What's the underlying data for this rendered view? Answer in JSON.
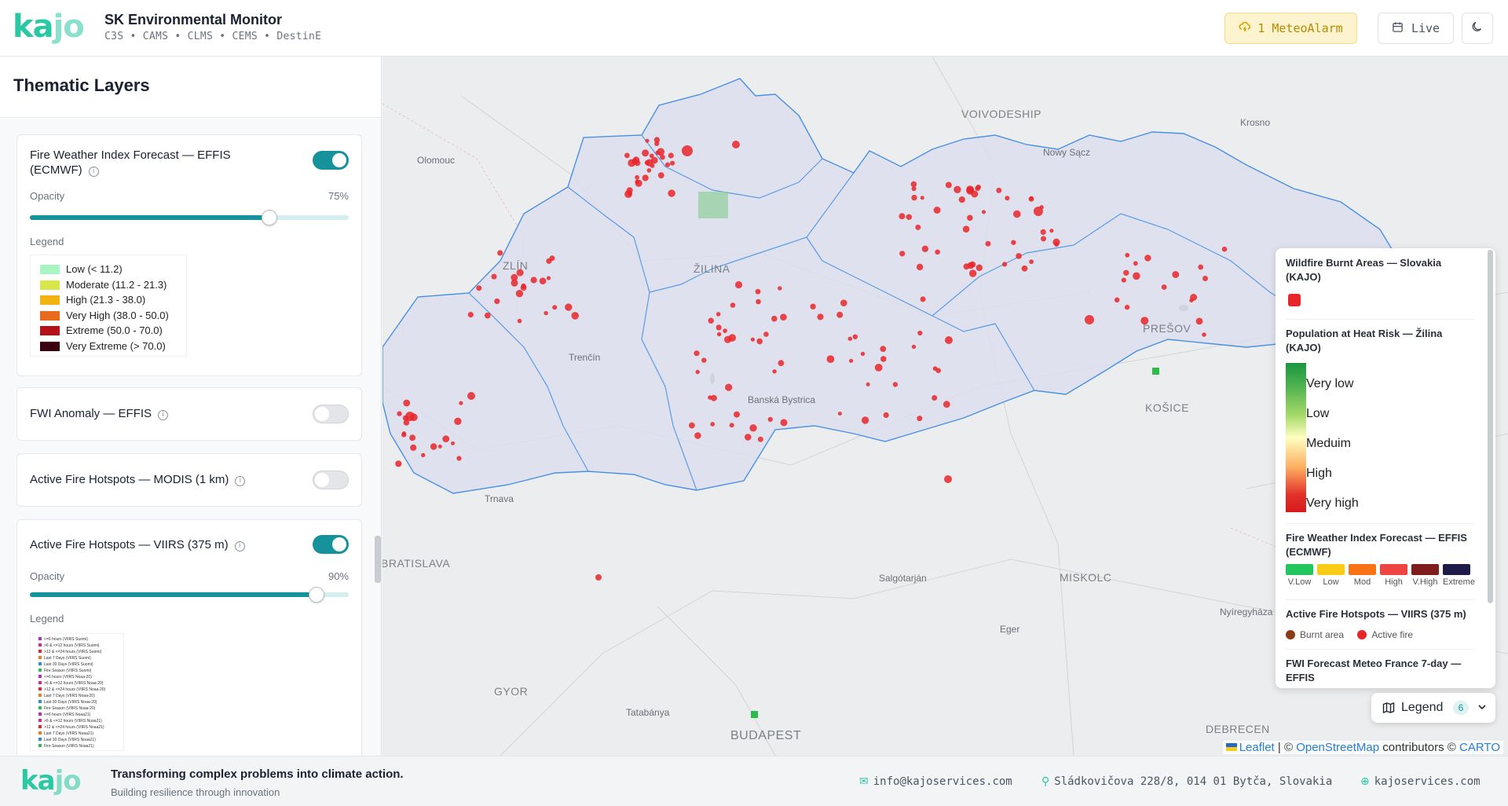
{
  "header": {
    "logo": "kajo",
    "title": "SK Environmental Monitor",
    "subtitle": "C3S • CAMS • CLMS • CEMS • DestinE",
    "alarm_label": "1 MeteoAlarm",
    "live_label": "Live"
  },
  "sidebar": {
    "title": "Thematic Layers",
    "layers": [
      {
        "title": "Fire Weather Index Forecast — EFFIS (ECMWF)",
        "enabled": true,
        "opacity_label": "Opacity",
        "opacity": "75%",
        "opacity_fraction": 0.75,
        "legend_label": "Legend",
        "legend": [
          {
            "label": "Low (< 11.2)",
            "color": "#a8f5c2"
          },
          {
            "label": "Moderate (11.2 - 21.3)",
            "color": "#d7e64a"
          },
          {
            "label": "High (21.3 - 38.0)",
            "color": "#f0b30f"
          },
          {
            "label": "Very High (38.0 - 50.0)",
            "color": "#e86a1d"
          },
          {
            "label": "Extreme (50.0 - 70.0)",
            "color": "#b5111b"
          },
          {
            "label": "Very Extreme (> 70.0)",
            "color": "#3b0010"
          }
        ]
      },
      {
        "title": "FWI Anomaly — EFFIS",
        "enabled": false
      },
      {
        "title": "Active Fire Hotspots — MODIS (1 km)",
        "enabled": false
      },
      {
        "title": "Active Fire Hotspots — VIIRS (375 m)",
        "enabled": true,
        "opacity_label": "Opacity",
        "opacity": "90%",
        "opacity_fraction": 0.9,
        "legend_label": "Legend",
        "legend_small": [
          {
            "label": "<=6 hours (VIIRS Suomi)",
            "color": "#c01fd6"
          },
          {
            "label": ">6 & <=12 hours (VIIRS Suomi)",
            "color": "#e01f9c"
          },
          {
            "label": ">12 & <=24 hours (VIIRS Suomi)",
            "color": "#ee2222"
          },
          {
            "label": "Last 7 Days (VIIRS Suomi)",
            "color": "#f07c14"
          },
          {
            "label": "Last 30 Days (VIIRS Suomi)",
            "color": "#2e8bd6"
          },
          {
            "label": "Fire Season (VIIRS Suomi)",
            "color": "#2ebd5a"
          },
          {
            "label": "<=6 hours (VIIRS Noaa-20)",
            "color": "#c01fd6"
          },
          {
            "label": ">6 & <=12 hours (VIIRS Noaa-20)",
            "color": "#e01f9c"
          },
          {
            "label": ">12 & <=24 hours (VIIRS Noaa-20)",
            "color": "#ee2222"
          },
          {
            "label": "Last 7 Days (VIIRS Noaa-20)",
            "color": "#f07c14"
          },
          {
            "label": "Last 30 Days (VIIRS Noaa-20)",
            "color": "#2e8bd6"
          },
          {
            "label": "Fire Season (VIIRS Noaa-20)",
            "color": "#2ebd5a"
          },
          {
            "label": "<=6 hours (VIIRS Noaa21)",
            "color": "#c01fd6"
          },
          {
            "label": ">6 & <=12 hours (VIIRS Noaa21)",
            "color": "#e01f9c"
          },
          {
            "label": ">12 & <=24 hours (VIIRS Noaa21)",
            "color": "#ee2222"
          },
          {
            "label": "Last 7 Days (VIIRS Noaa21)",
            "color": "#f07c14"
          },
          {
            "label": "Last 30 Days (VIIRS Noaa21)",
            "color": "#2e8bd6"
          },
          {
            "label": "Fire Season (VIIRS Noaa21)",
            "color": "#2ebd5a"
          }
        ]
      }
    ]
  },
  "map": {
    "cities": [
      "VOIVODESHIP",
      "Krosno",
      "Olomouc",
      "Nowy Sącz",
      "ZLÍN",
      "ŽILINA",
      "PREŠOV",
      "Trenčín",
      "Banská Bystrica",
      "KOŠICE",
      "Trnava",
      "BRATISLAVA",
      "Salgótarján",
      "MISKOLC",
      "Nyíregyháza",
      "Eger",
      "GYOR",
      "Tatabánya",
      "BUDAPEST",
      "DEBRECEN"
    ],
    "attribution": {
      "leaflet": "Leaflet",
      "sep": " | © ",
      "osm": "OpenStreetMap",
      "contrib": " contributors © ",
      "carto": "CARTO"
    }
  },
  "legend_panel": {
    "burnt": {
      "title": "Wildfire Burnt Areas — Slovakia (KAJO)",
      "color": "#e8262a"
    },
    "heat": {
      "title": "Population at Heat Risk — Žilina (KAJO)",
      "levels": [
        "Very low",
        "Low",
        "Meduim",
        "High",
        "Very high"
      ]
    },
    "fwi": {
      "title": "Fire Weather Index Forecast — EFFIS (ECMWF)",
      "classes": [
        {
          "label": "V.Low",
          "color": "#22c55e"
        },
        {
          "label": "Low",
          "color": "#facc15"
        },
        {
          "label": "Mod",
          "color": "#f97316"
        },
        {
          "label": "High",
          "color": "#ef4444"
        },
        {
          "label": "V.High",
          "color": "#7f1d1d"
        },
        {
          "label": "Extreme",
          "color": "#1e1b4b"
        }
      ]
    },
    "viirs": {
      "title": "Active Fire Hotspots — VIIRS (375 m)",
      "items": [
        {
          "label": "Burnt area",
          "color": "#8b3a16"
        },
        {
          "label": "Active fire",
          "color": "#e8262a"
        }
      ]
    },
    "fwi_mf": {
      "title": "FWI Forecast Meteo France 7-day — EFFIS"
    },
    "button_label": "Legend",
    "count": "6"
  },
  "footer": {
    "logo": "kajo",
    "tagline": "Transforming complex problems into climate action.",
    "sub": "Building resilience through innovation",
    "email": "info@kajoservices.com",
    "address": "Sládkovičova 228/8, 014 01 Bytča, Slovakia",
    "website": "kajoservices.com"
  }
}
